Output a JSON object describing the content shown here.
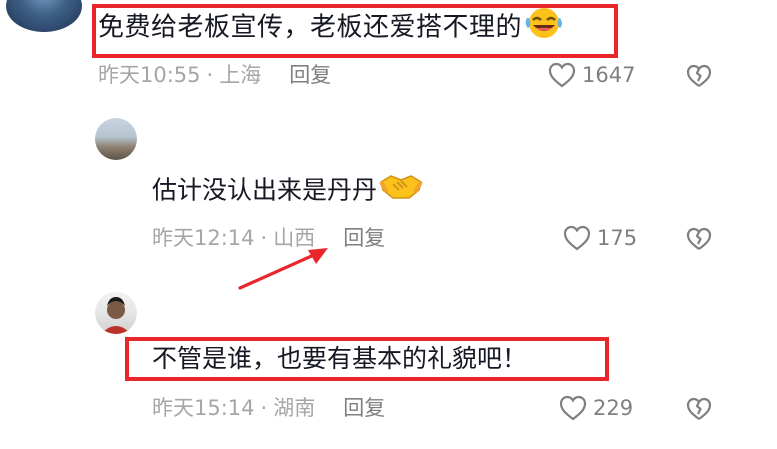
{
  "comments": [
    {
      "text": "免费给老板宣传，老板还爱搭不理的",
      "emoji": "laughing-crying-face",
      "time": "昨天10:55",
      "location": "上海",
      "reply_label": "回复",
      "likes": "1647"
    },
    {
      "username": "",
      "text": "估计没认出来是丹丹",
      "emoji": "handshake",
      "time": "昨天12:14",
      "location": "山西",
      "reply_label": "回复",
      "likes": "175"
    },
    {
      "username": "",
      "text": "不管是谁，也要有基本的礼貌吧！",
      "time": "昨天15:14",
      "location": "湖南",
      "reply_label": "回复",
      "likes": "229"
    }
  ],
  "meta_separator": "·",
  "colors": {
    "highlight_box": "#e8262c",
    "arrow": "#e8262c",
    "text": "#161823",
    "meta": "#a6a6a6"
  },
  "icons": {
    "like": "heart-outline-icon",
    "dislike": "broken-heart-icon"
  }
}
